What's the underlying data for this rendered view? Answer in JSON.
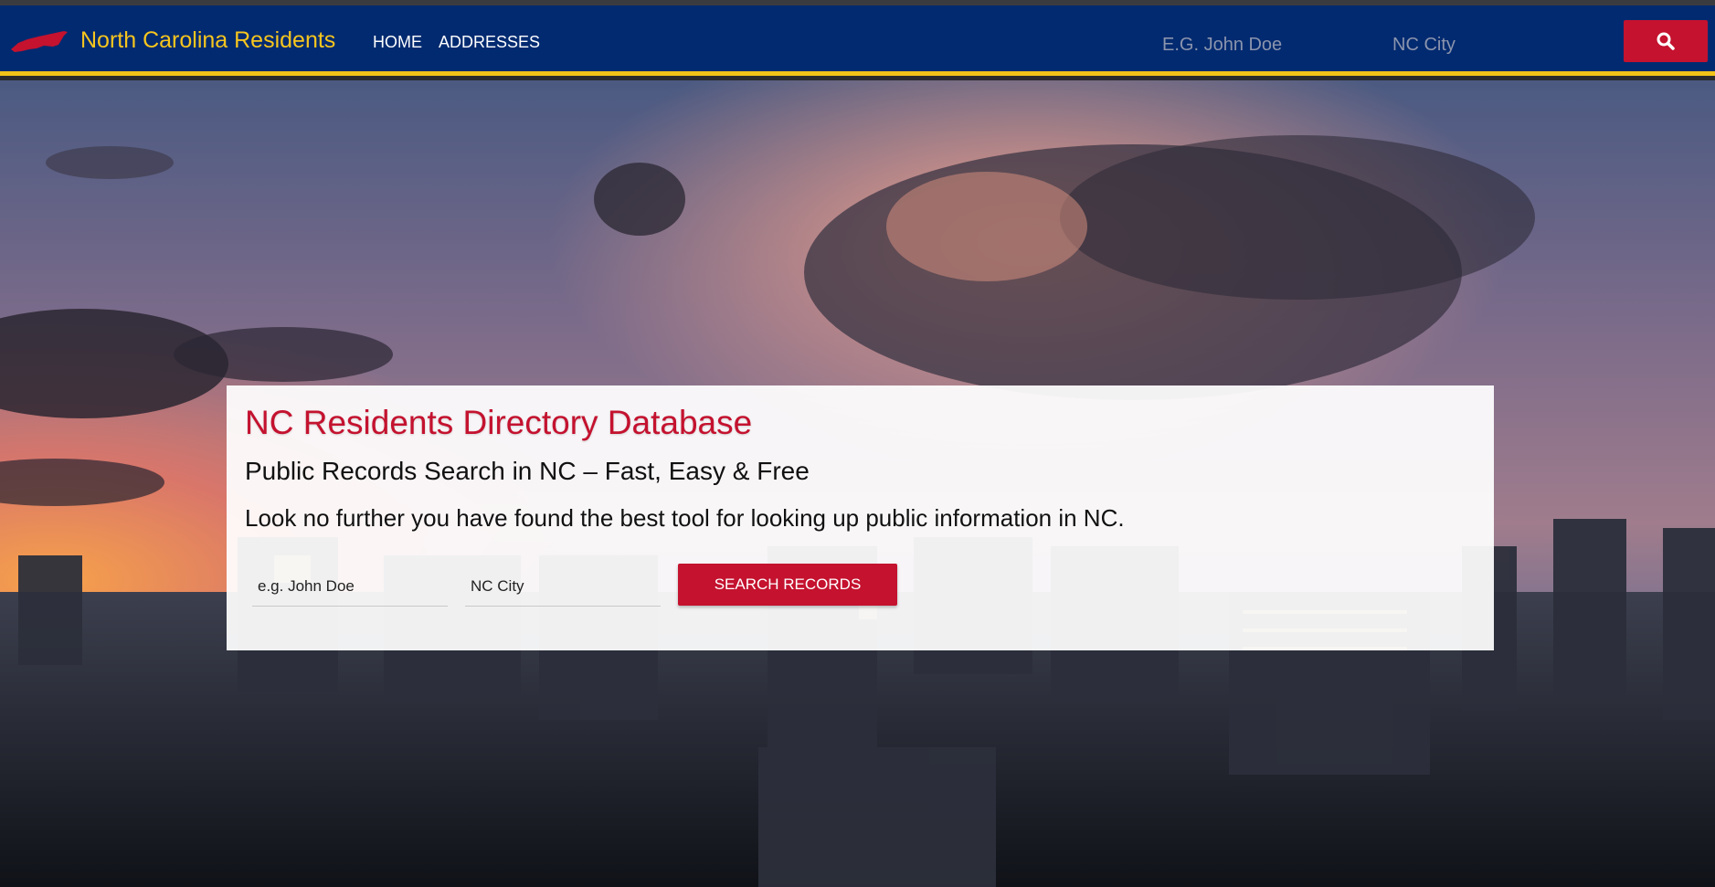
{
  "header": {
    "brand_name": "North Carolina Residents",
    "brand_icon": "nc-state-shape-icon",
    "nav_items": [
      "HOME",
      "ADDRESSES"
    ],
    "search": {
      "name_placeholder": "E.G. John Doe",
      "city_placeholder": "NC City",
      "button_icon": "search-icon"
    }
  },
  "hero": {
    "background": "city-skyline-sunset-photo",
    "title": "NC Residents Directory Database",
    "subtitle": "Public Records Search in NC – Fast, Easy & Free",
    "description": "Look no further you have found the best tool for looking up public information in NC.",
    "search": {
      "name_placeholder": "e.g. John Doe",
      "city_placeholder": "NC City",
      "button_label": "SEARCH RECORDS"
    }
  },
  "colors": {
    "navbar": "#022a70",
    "navbar_border": "#f2c318",
    "brand_text": "#f7c51e",
    "accent_red": "#c4122f"
  }
}
